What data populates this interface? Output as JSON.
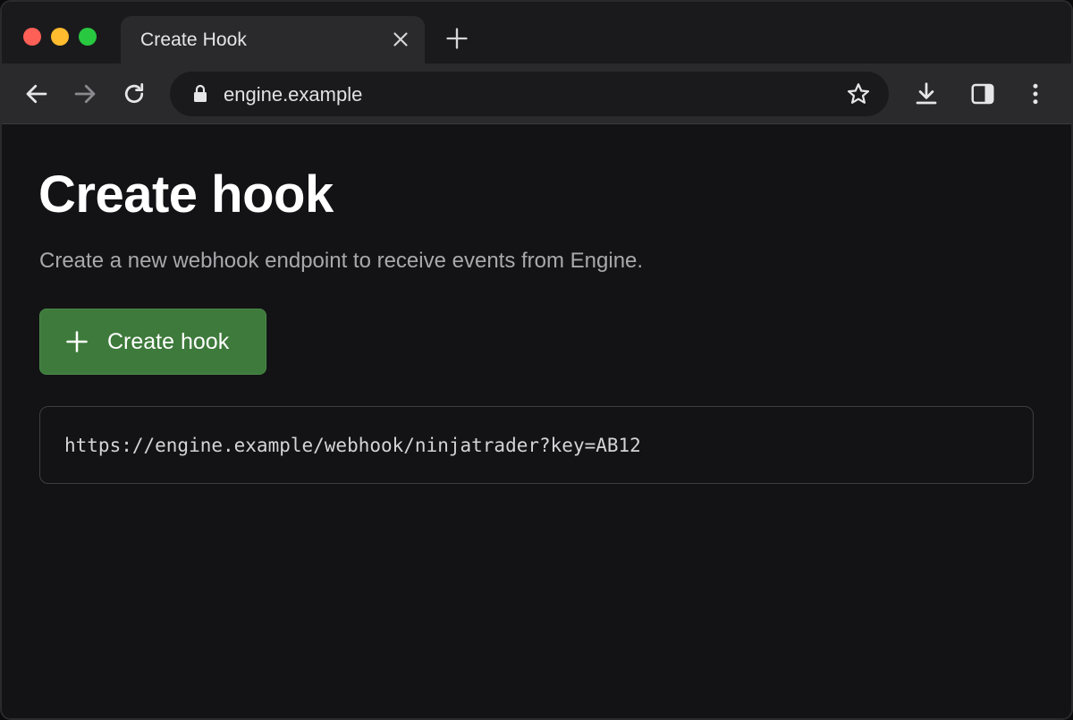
{
  "browser": {
    "tab_title": "Create Hook",
    "url": "engine.example",
    "icons": [
      "close-icon",
      "plus-icon",
      "back-arrow-icon",
      "forward-arrow-icon",
      "reload-icon",
      "lock-icon",
      "star-icon",
      "download-icon",
      "sidebar-icon",
      "more-vert-icon"
    ]
  },
  "page": {
    "title": "Create hook",
    "subtitle": "Create a new webhook endpoint to receive events from Engine.",
    "create_button_label": "Create hook",
    "webhook_url": "https://engine.example/webhook/ninjatrader?key=AB12"
  },
  "colors": {
    "button_green": "#3d7a3b",
    "background": "#131316"
  }
}
